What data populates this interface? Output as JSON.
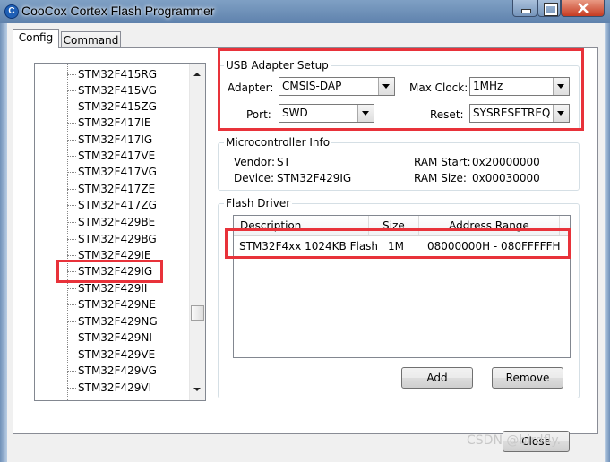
{
  "window": {
    "title": "CooCox Cortex Flash Programmer",
    "app_icon_glyph": "C"
  },
  "tabs": [
    {
      "label": "Config",
      "selected": true
    },
    {
      "label": "Command",
      "selected": false
    }
  ],
  "device_tree": {
    "items": [
      "STM32F415RG",
      "STM32F415VG",
      "STM32F415ZG",
      "STM32F417IE",
      "STM32F417IG",
      "STM32F417VE",
      "STM32F417VG",
      "STM32F417ZE",
      "STM32F417ZG",
      "STM32F429BE",
      "STM32F429BG",
      "STM32F429IE",
      "STM32F429IG",
      "STM32F429II",
      "STM32F429NE",
      "STM32F429NG",
      "STM32F429NI",
      "STM32F429VE",
      "STM32F429VG",
      "STM32F429VI"
    ],
    "selected_index": 12
  },
  "usb_adapter": {
    "title": "USB Adapter Setup",
    "adapter_label": "Adapter:",
    "adapter_value": "CMSIS-DAP",
    "max_clock_label": "Max Clock:",
    "max_clock_value": "1MHz",
    "port_label": "Port:",
    "port_value": "SWD",
    "reset_label": "Reset:",
    "reset_value": "SYSRESETREQ"
  },
  "mcu_info": {
    "title": "Microcontroller Info",
    "vendor_label": "Vendor:",
    "vendor_value": "ST",
    "device_label": "Device:",
    "device_value": "STM32F429IG",
    "ram_start_label": "RAM Start:",
    "ram_start_value": "0x20000000",
    "ram_size_label": "RAM Size:",
    "ram_size_value": "0x00030000"
  },
  "flash_driver": {
    "title": "Flash Driver",
    "columns": [
      "Description",
      "Size",
      "Address Range"
    ],
    "rows": [
      {
        "description": "STM32F4xx 1024KB Flash",
        "size": "1M",
        "address_range": "08000000H - 080FFFFFH"
      }
    ],
    "add_label": "Add",
    "remove_label": "Remove"
  },
  "footer": {
    "close_label": "Close"
  },
  "watermark": "CSDN @birdfly.",
  "colors": {
    "highlight": "#e8323a",
    "title_bar": "#6f90b8"
  }
}
